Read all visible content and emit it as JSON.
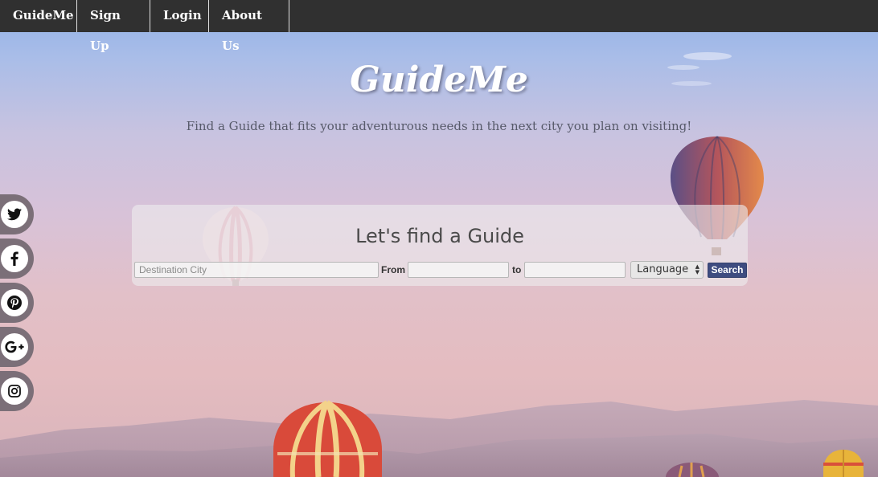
{
  "nav": {
    "brand": "GuideMe",
    "signup": "Sign Up",
    "login": "Login",
    "about": "About Us"
  },
  "hero": {
    "title": "GuideMe",
    "subtitle": "Find a Guide that fits your adventurous needs in the next city you plan on visiting!"
  },
  "search": {
    "heading": "Let's find a Guide",
    "destination_placeholder": "Destination City",
    "destination_value": "",
    "from_label": "From",
    "from_value": "",
    "to_label": "to",
    "to_value": "",
    "language_selected": "Language",
    "button_label": "Search"
  },
  "social": {
    "icons": [
      "twitter-icon",
      "facebook-icon",
      "pinterest-icon",
      "google-plus-icon",
      "instagram-icon"
    ]
  },
  "colors": {
    "navbar": "#303030",
    "search_button": "#3e4c80",
    "social_tab": "#7b6f78"
  }
}
